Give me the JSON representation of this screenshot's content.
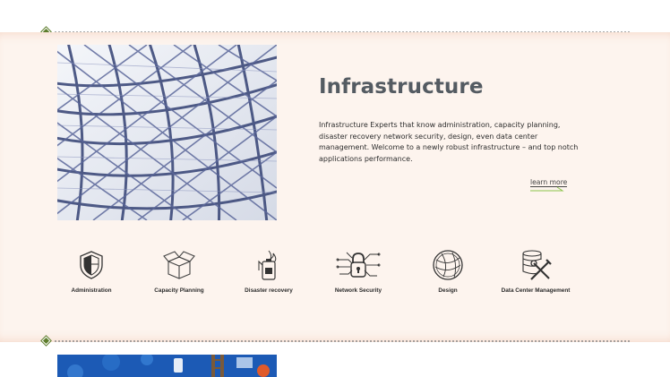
{
  "section": {
    "title": "Infrastructure",
    "description": "Infrastructure Experts that know administration, capacity planning, disaster recovery network security, design, even data center management. Welcome to a newly robust infrastructure – and top notch applications performance.",
    "learn_more": "learn more"
  },
  "services": [
    {
      "label": "Administration",
      "icon": "shield-icon"
    },
    {
      "label": "Capacity Planning",
      "icon": "box-icon"
    },
    {
      "label": "Disaster recovery",
      "icon": "fire-extinguisher-icon"
    },
    {
      "label": "Network Security",
      "icon": "network-lock-icon"
    },
    {
      "label": "Design",
      "icon": "globe-icon"
    },
    {
      "label": "Data Center Management",
      "icon": "database-tools-icon"
    }
  ],
  "colors": {
    "section_bg": "#fdf4ee",
    "title": "#545b62",
    "accent": "#5d7d2c",
    "learn_more_arrow": "#8bc34a"
  }
}
